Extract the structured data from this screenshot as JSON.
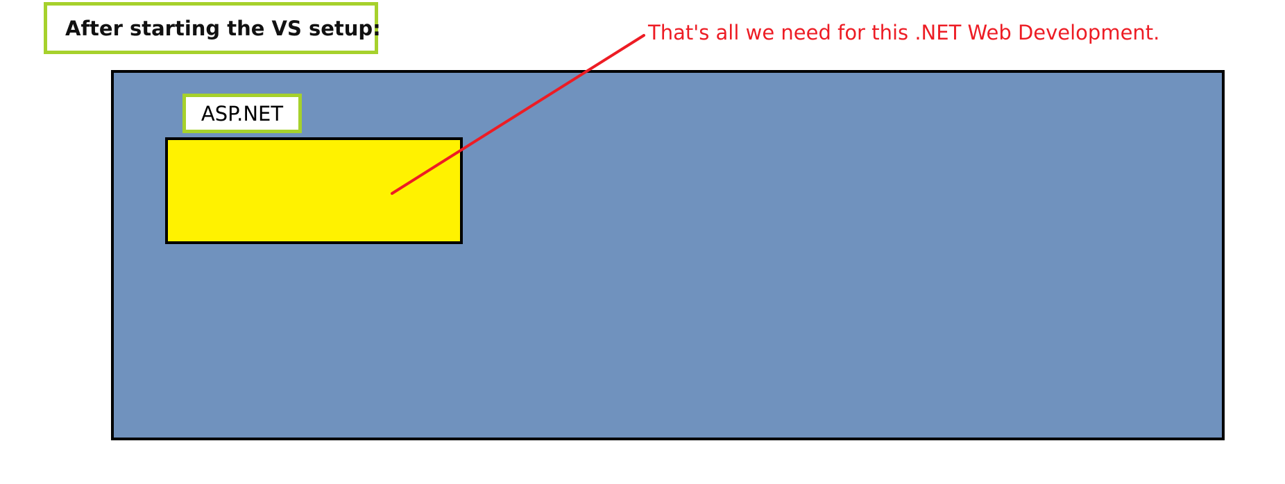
{
  "heading": {
    "text": "After starting the VS setup:"
  },
  "callout": {
    "text": "That's all we need for this .NET Web Development.",
    "color": "#ed1c24"
  },
  "setup_window": {
    "background_color": "#7092be",
    "workload": {
      "label": "ASP.NET",
      "tile_color": "#fff200"
    }
  },
  "colors": {
    "label_border": "#a6d12c",
    "outline": "#000000"
  }
}
